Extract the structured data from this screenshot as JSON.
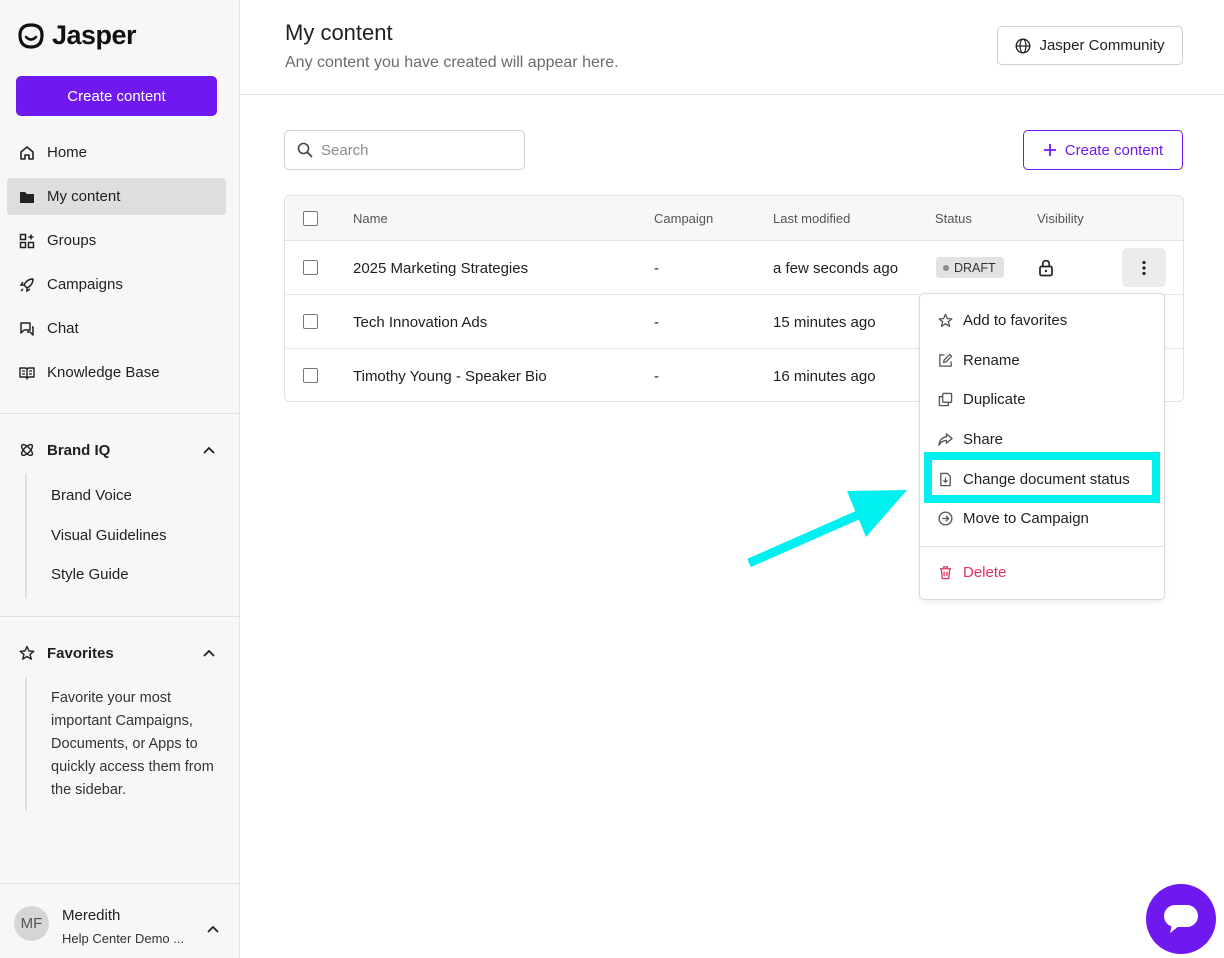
{
  "brand": {
    "name": "Jasper"
  },
  "sidebar": {
    "create_label": "Create content",
    "nav": [
      {
        "label": "Home",
        "icon": "home-icon"
      },
      {
        "label": "My content",
        "icon": "folder-icon"
      },
      {
        "label": "Groups",
        "icon": "groups-icon"
      },
      {
        "label": "Campaigns",
        "icon": "rocket-icon"
      },
      {
        "label": "Chat",
        "icon": "chat-icon"
      },
      {
        "label": "Knowledge Base",
        "icon": "book-icon"
      }
    ],
    "brand_iq": {
      "label": "Brand IQ",
      "items": [
        "Brand Voice",
        "Visual Guidelines",
        "Style Guide"
      ]
    },
    "favorites": {
      "label": "Favorites",
      "empty_text": "Favorite your most important Campaigns, Documents, or Apps to quickly access them from the sidebar."
    },
    "user": {
      "initials": "MF",
      "name": "Meredith",
      "org": "Help Center Demo ..."
    }
  },
  "header": {
    "title": "My content",
    "subtitle": "Any content you have created will appear here.",
    "community_label": "Jasper Community"
  },
  "toolbar": {
    "search_placeholder": "Search",
    "create_label": "Create content"
  },
  "table": {
    "columns": [
      "Name",
      "Campaign",
      "Last modified",
      "Status",
      "Visibility"
    ],
    "rows": [
      {
        "name": "2025 Marketing Strategies",
        "campaign": "-",
        "modified": "a few seconds ago",
        "status": "DRAFT"
      },
      {
        "name": "Tech Innovation Ads",
        "campaign": "-",
        "modified": "15 minutes ago"
      },
      {
        "name": "Timothy Young - Speaker Bio",
        "campaign": "-",
        "modified": "16 minutes ago"
      }
    ]
  },
  "menu": {
    "items": [
      {
        "label": "Add to favorites",
        "icon": "star-icon"
      },
      {
        "label": "Rename",
        "icon": "edit-icon"
      },
      {
        "label": "Duplicate",
        "icon": "duplicate-icon"
      },
      {
        "label": "Share",
        "icon": "share-icon"
      },
      {
        "label": "Change document status",
        "icon": "document-status-icon"
      },
      {
        "label": "Move to Campaign",
        "icon": "arrow-circle-icon"
      },
      {
        "label": "Delete",
        "icon": "trash-icon"
      }
    ]
  },
  "colors": {
    "accent": "#7018f0",
    "highlight": "#00f0f0",
    "danger": "#e0345a"
  }
}
